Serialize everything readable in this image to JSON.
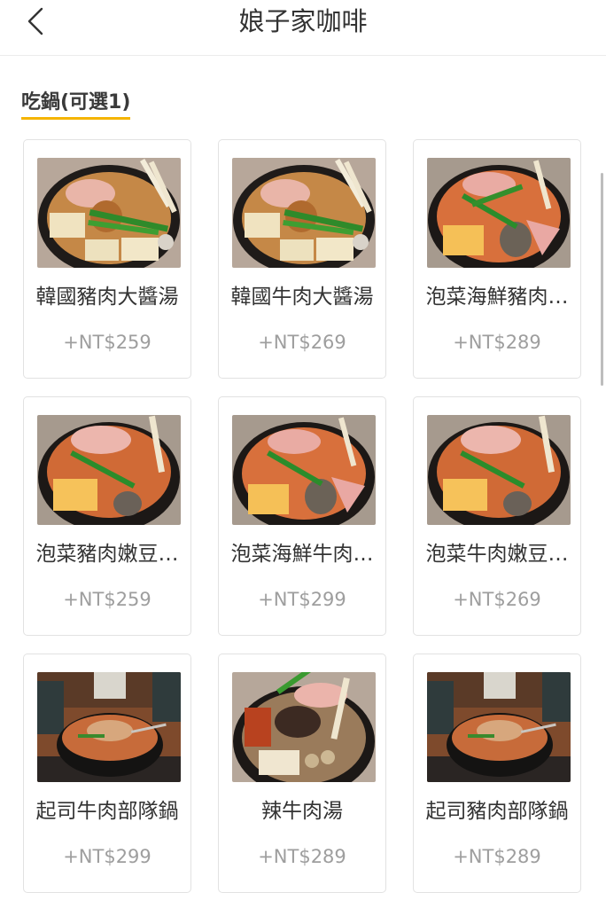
{
  "header": {
    "title": "娘子家咖啡",
    "back_icon": "chevron-left-icon"
  },
  "section": {
    "title": "吃鍋(可選1)",
    "accent_color": "#f5b400"
  },
  "items": [
    {
      "name": "韓國豬肉大醬湯",
      "price": "+NT$259",
      "image": "doenjang-pork-stew"
    },
    {
      "name": "韓國牛肉大醬湯",
      "price": "+NT$269",
      "image": "doenjang-beef-stew"
    },
    {
      "name": "泡菜海鮮豬肉…",
      "price": "+NT$289",
      "image": "kimchi-seafood-pork-pot"
    },
    {
      "name": "泡菜豬肉嫩豆…",
      "price": "+NT$259",
      "image": "kimchi-pork-tofu-pot"
    },
    {
      "name": "泡菜海鮮牛肉…",
      "price": "+NT$299",
      "image": "kimchi-seafood-beef-pot"
    },
    {
      "name": "泡菜牛肉嫩豆…",
      "price": "+NT$269",
      "image": "kimchi-beef-tofu-pot"
    },
    {
      "name": "起司牛肉部隊鍋",
      "price": "+NT$299",
      "image": "cheese-beef-army-stew"
    },
    {
      "name": "辣牛肉湯",
      "price": "+NT$289",
      "image": "spicy-beef-soup"
    },
    {
      "name": "起司豬肉部隊鍋",
      "price": "+NT$289",
      "image": "cheese-pork-army-stew"
    }
  ]
}
